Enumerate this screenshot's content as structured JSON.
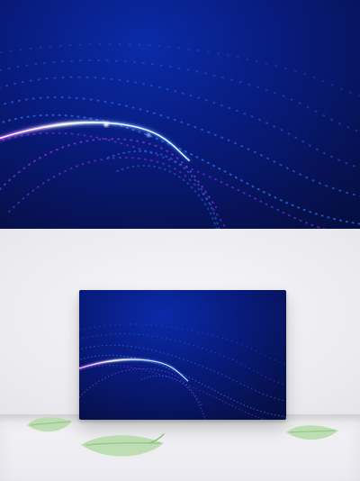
{
  "scene": {
    "hero": {
      "theme": "abstract particle wave",
      "colors": {
        "bg_dark": "#040a2b",
        "bg_mid": "#081a78",
        "accent_blue": "#2b7bff",
        "accent_purple": "#b23cff",
        "highlight": "#ffffff"
      }
    },
    "mockup": {
      "wall_color": "#ececef",
      "floor_color": "#eaeaf0"
    },
    "decor": {
      "leaf_color": "#b9dcae",
      "leaf_vein": "#9ec88f"
    }
  }
}
